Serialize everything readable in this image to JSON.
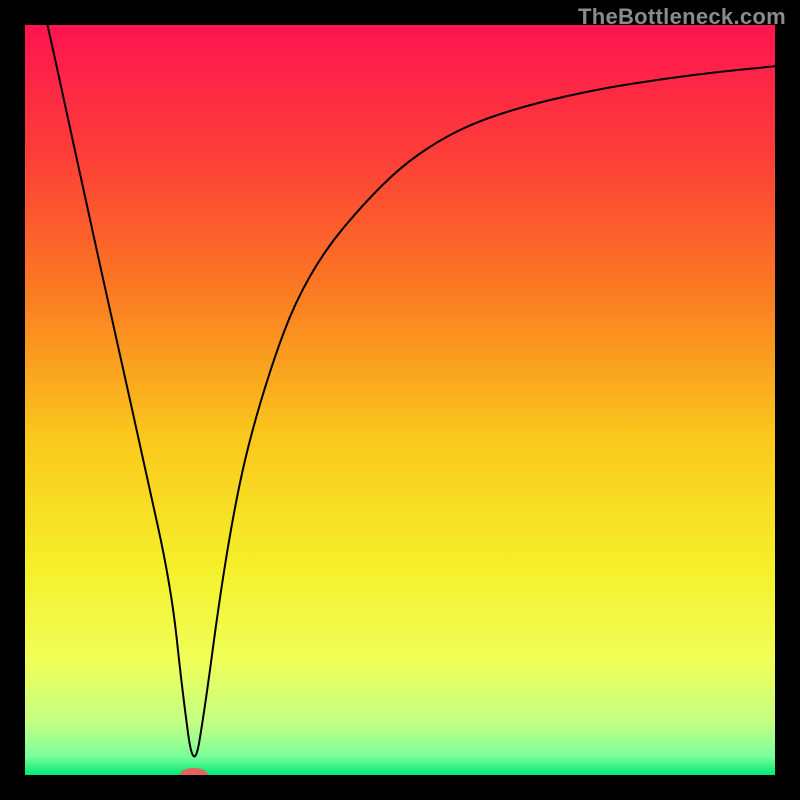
{
  "watermark": "TheBottleneck.com",
  "chart_data": {
    "type": "line",
    "title": "",
    "xlabel": "",
    "ylabel": "",
    "xlim": [
      0,
      100
    ],
    "ylim": [
      0,
      100
    ],
    "grid": false,
    "legend": false,
    "background": {
      "type": "vertical-gradient",
      "stops": [
        {
          "offset": 0.0,
          "color": "#ff1450"
        },
        {
          "offset": 0.18,
          "color": "#fd4037"
        },
        {
          "offset": 0.36,
          "color": "#fb7c22"
        },
        {
          "offset": 0.55,
          "color": "#fac81c"
        },
        {
          "offset": 0.72,
          "color": "#f6ef2a"
        },
        {
          "offset": 0.85,
          "color": "#efff59"
        },
        {
          "offset": 0.93,
          "color": "#c3ff84"
        },
        {
          "offset": 0.975,
          "color": "#7aff9a"
        },
        {
          "offset": 1.0,
          "color": "#00e876"
        }
      ]
    },
    "series": [
      {
        "name": "bottleneck-curve",
        "x": [
          3,
          5,
          8,
          12,
          16,
          19.5,
          21,
          22.5,
          24,
          26,
          28,
          30,
          33,
          36,
          40,
          45,
          50,
          55,
          60,
          66,
          72,
          78,
          85,
          92,
          100
        ],
        "y": [
          100,
          91,
          77,
          59,
          41,
          25,
          11,
          0,
          9,
          24,
          36,
          45,
          55,
          63,
          70,
          76,
          81,
          84.5,
          87,
          89,
          90.5,
          91.7,
          92.8,
          93.7,
          94.5
        ]
      }
    ],
    "markers": [
      {
        "name": "target-marker",
        "x": 22.5,
        "y": 0,
        "color": "#e2645a",
        "shape": "capsule",
        "rx": 6,
        "ry": 3
      }
    ]
  }
}
